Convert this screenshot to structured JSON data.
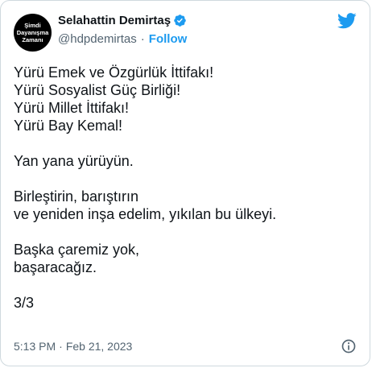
{
  "author": {
    "name": "Selahattin Demirtaş",
    "handle": "@hdpdemirtas",
    "avatar_text": [
      "Şimdi",
      "Dayanışma",
      "Zamanı"
    ],
    "verified": true,
    "verified_color": "#1d9bf0"
  },
  "follow_label": "Follow",
  "separator": "·",
  "tweet_lines": [
    "Yürü Emek ve Özgürlük İttifakı!",
    "Yürü Sosyalist Güç Birliği!",
    "Yürü Millet İttifakı!",
    "Yürü Bay Kemal!",
    "",
    "Yan yana yürüyün.",
    "",
    "Birleştirin, barıştırın",
    "ve yeniden inşa edelim, yıkılan bu ülkeyi.",
    "",
    "Başka çaremiz yok,",
    "başaracağız.",
    "",
    "3/3"
  ],
  "timestamp": {
    "time": "5:13 PM",
    "date": "Feb 21, 2023"
  },
  "icons": {
    "brand": "twitter-bird-icon",
    "info": "info-icon",
    "verified": "verified-badge-icon"
  },
  "colors": {
    "accent": "#1d9bf0",
    "text": "#0f1419",
    "muted": "#536471"
  }
}
